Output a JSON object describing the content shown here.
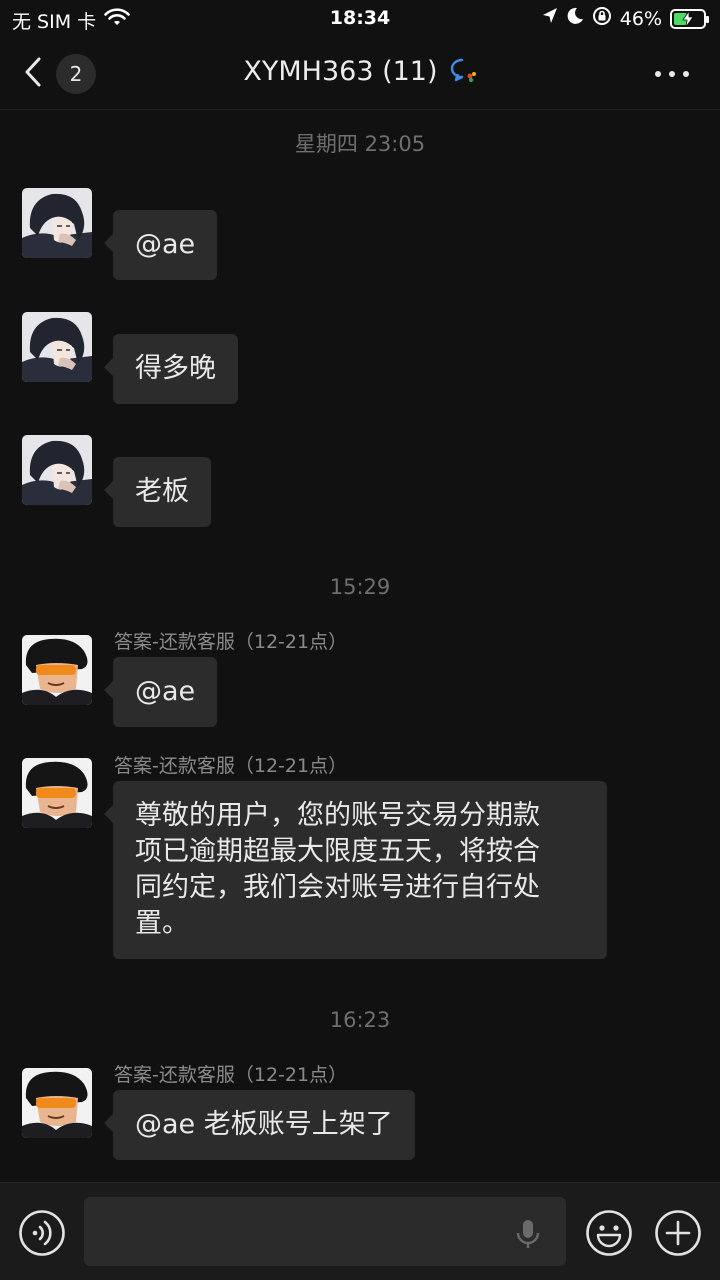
{
  "status_bar": {
    "carrier": "无 SIM 卡",
    "time": "18:34",
    "battery": "46%",
    "battery_level": 0.46
  },
  "header": {
    "unread_count": "2",
    "title": "XYMH363 (11)"
  },
  "messages": [
    {
      "type": "time",
      "text": "星期四 23:05"
    },
    {
      "type": "msg",
      "sender": "",
      "text": "@ae"
    },
    {
      "type": "msg",
      "sender": "",
      "text": "得多晚"
    },
    {
      "type": "msg",
      "sender": "",
      "text": "老板"
    },
    {
      "type": "time",
      "text": "15:29"
    },
    {
      "type": "msg",
      "sender": "答案-还款客服（12-21点）",
      "text": "@ae"
    },
    {
      "type": "msg",
      "sender": "答案-还款客服（12-21点）",
      "text_lines": [
        "尊敬的用户，您的账号交易分期款",
        "项已逾期超最大限度五天，将按合",
        "同约定，我们会对账号进行自行处",
        "置。"
      ]
    },
    {
      "type": "time",
      "text": "16:23"
    },
    {
      "type": "msg",
      "sender": "答案-还款客服（12-21点）",
      "text": "@ae 老板账号上架了"
    }
  ],
  "input": {
    "value": "",
    "placeholder": ""
  },
  "icons": {
    "back": "chevron-left-icon",
    "more": "more-dots-icon",
    "voice": "voice-icon",
    "mic": "mic-icon",
    "emoji": "emoji-icon",
    "plus": "plus-icon"
  }
}
